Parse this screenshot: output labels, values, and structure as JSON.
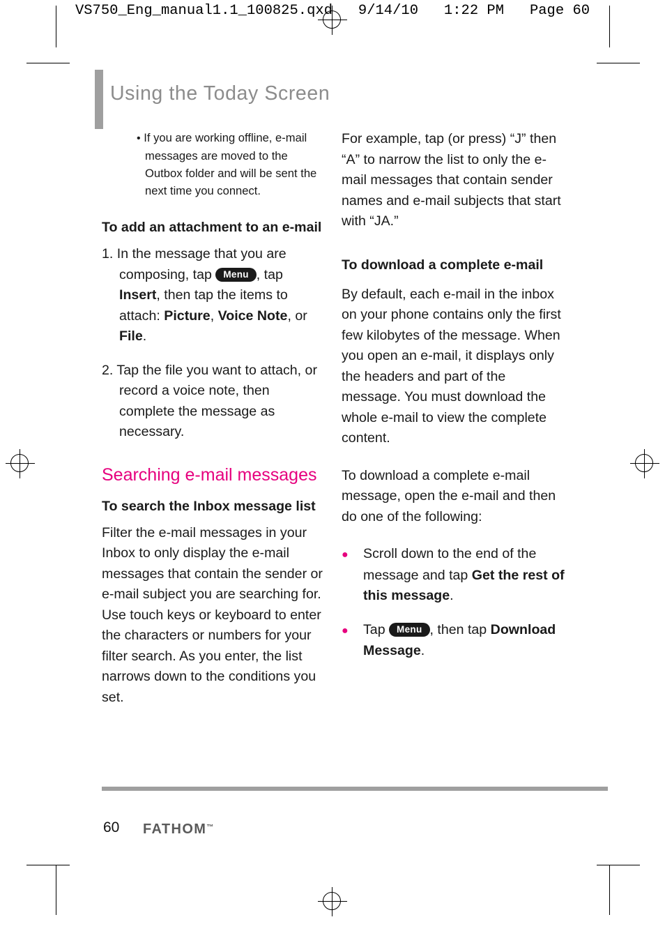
{
  "print_header": "VS750_Eng_manual1.1_100825.qxd   9/14/10   1:22 PM   Page 60",
  "chapter_title": "Using the Today Screen",
  "left_column": {
    "note": "If you are working offline, e-mail messages are moved to the Outbox folder and will be sent the next time you connect.",
    "heading_attachment": "To add an attachment to an e-mail",
    "step1_a": "1. In the message that you are composing, tap",
    "step1_menu": "Menu",
    "step1_b": ", tap",
    "step1_insert": "Insert",
    "step1_c": ", then tap the items to attach:",
    "step1_picture": "Picture",
    "step1_comma1": ",",
    "step1_voicenote": "Voice Note",
    "step1_or": ", or",
    "step1_file": "File",
    "step1_period": ".",
    "step2": "2. Tap the file you want to attach, or record a voice note, then complete the message as necessary.",
    "heading_searching": "Searching e-mail messages",
    "heading_search_inbox": "To search the Inbox message list",
    "search_para": "Filter the e-mail messages in your Inbox to only display the e-mail messages that contain the sender or e-mail subject you are searching for. Use touch keys or keyboard to enter the characters or numbers for your filter search. As you enter, the list narrows down to the conditions you set."
  },
  "right_column": {
    "example_para": "For example, tap (or press) “J” then “A” to narrow the list to only the e-mail messages that contain sender names and e-mail subjects that start with “JA.”",
    "heading_download": "To download a complete e-mail",
    "download_para1": "By default, each e-mail in the inbox on your phone contains only the first few kilobytes of the message. When you open an e-mail, it displays only the headers and part of the message. You must download the whole e-mail to view the complete content.",
    "download_para2": "To download a complete e-mail message, open the e-mail and then do one of the following:",
    "bullet1_a": "Scroll down to the end of the message and tap",
    "bullet1_bold": "Get the rest of this message",
    "bullet1_b": ".",
    "bullet2_a": "Tap",
    "bullet2_menu": "Menu",
    "bullet2_b": ", then tap",
    "bullet2_bold": "Download Message",
    "bullet2_c": "."
  },
  "footer": {
    "page_number": "60",
    "brand": "FATHOM",
    "trademark": "™"
  },
  "colors": {
    "accent_pink": "#e6007e",
    "title_gray": "#8c8c8c",
    "rule_gray": "#9f9f9f"
  }
}
